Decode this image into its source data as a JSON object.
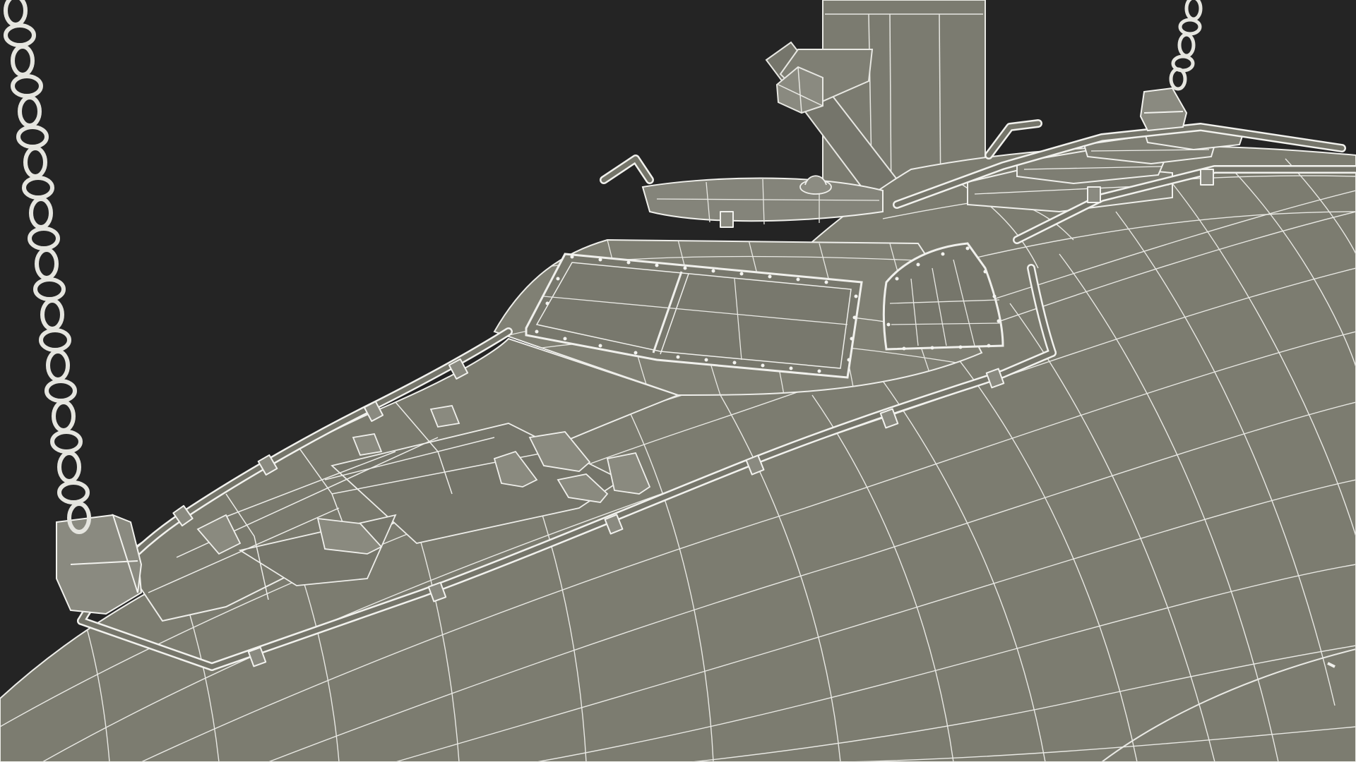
{
  "viewport": {
    "background_color": "#242424",
    "mesh_fill_color": "#7c7c70",
    "mesh_fill_dark_color": "#6c6c61",
    "wire_color": "#eeeeea",
    "render_mode": "wireframe-on-shaded",
    "subject": "hanging-capsule-with-chains"
  }
}
